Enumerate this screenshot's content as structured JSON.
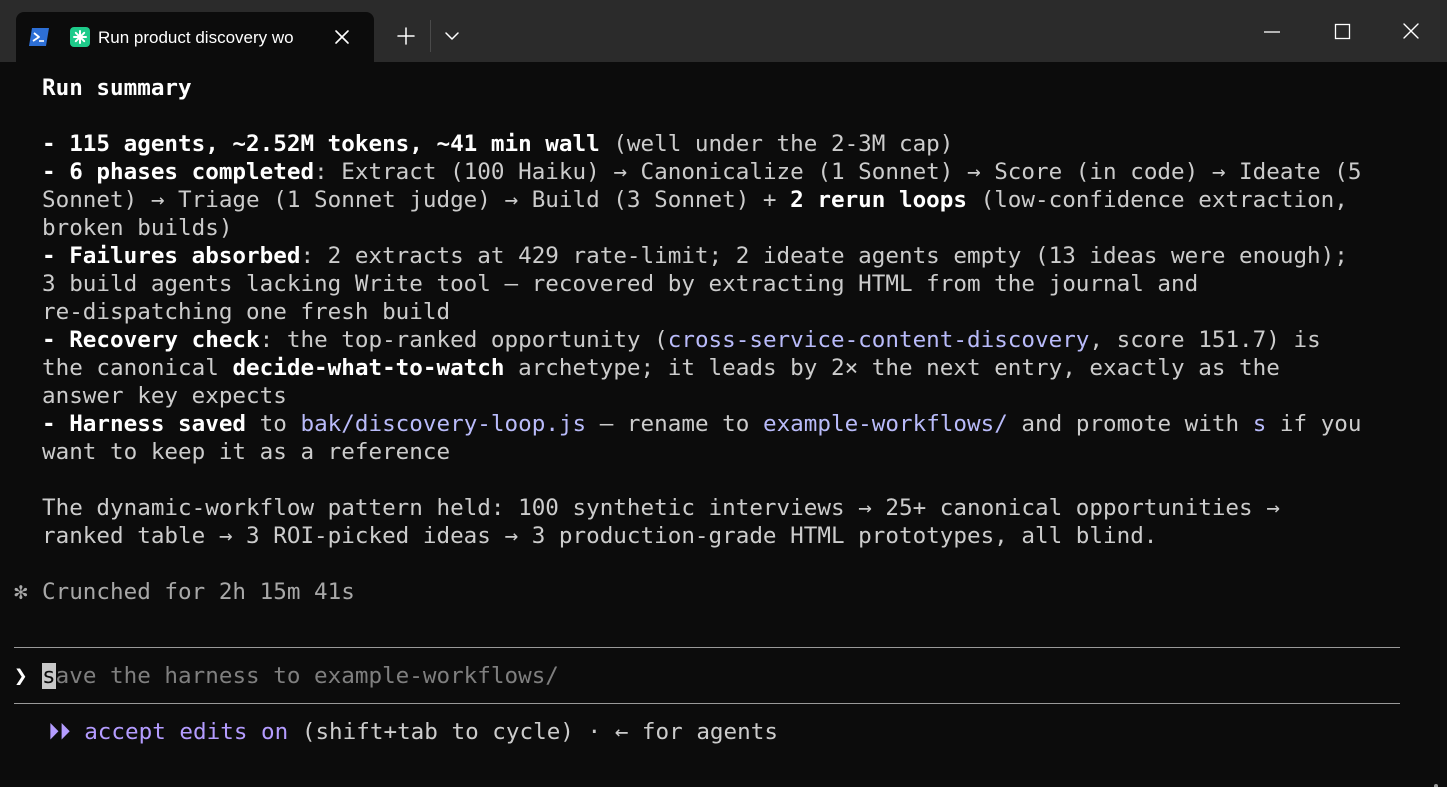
{
  "titlebar": {
    "tab_title": "Run product discovery wo",
    "tab_icon": "powershell-icon",
    "tab_app_icon": "claude-asterisk-icon",
    "accent_color": "#1ecb8a"
  },
  "terminal": {
    "summary_title": "Run summary",
    "l1": {
      "b1": "- 115 agents, ~2.52M tokens, ~41 min wall",
      "t1": " (well under the 2-3M cap)"
    },
    "l2": {
      "b1": "- 6 phases completed",
      "t1": ": Extract (100 Haiku) → Canonicalize (1 Sonnet) → Score (in code) → Ideate (5"
    },
    "l3": {
      "t1": "Sonnet) → Triage (1 Sonnet judge) → Build (3 Sonnet) + ",
      "b1": "2 rerun loops",
      "t2": " (low-confidence extraction,"
    },
    "l4": {
      "t1": "broken builds)"
    },
    "l5": {
      "b1": "- Failures absorbed",
      "t1": ": 2 extracts at 429 rate-limit; 2 ideate agents empty (13 ideas were enough);"
    },
    "l6": {
      "t1": "3 build agents lacking Write tool — recovered by extracting HTML from the journal and"
    },
    "l7": {
      "t1": "re-dispatching one fresh build"
    },
    "l8": {
      "b1": "- Recovery check",
      "t1": ": the top-ranked opportunity (",
      "c1": "cross-service-content-discovery",
      "t2": ", score 151.7) is"
    },
    "l9": {
      "t1": "the canonical ",
      "b1": "decide-what-to-watch",
      "t2": " archetype; it leads by 2× the next entry, exactly as the"
    },
    "l10": {
      "t1": "answer key expects"
    },
    "l11": {
      "b1": "- Harness saved",
      "t1": " to ",
      "c1": "bak/discovery-loop.js",
      "t2": " — rename to ",
      "c2": "example-workflows/",
      "t3": " and promote with ",
      "c3": "s",
      "t4": " if you"
    },
    "l12": {
      "t1": "want to keep it as a reference"
    },
    "l13": {
      "t1": "The dynamic-workflow pattern held: 100 synthetic interviews → 25+ canonical opportunities →"
    },
    "l14": {
      "t1": "ranked table → 3 ROI-picked ideas → 3 production-grade HTML prototypes, all blind."
    },
    "spinner_glyph": "✻",
    "crunched": "Crunched for 2h 15m 41s",
    "prompt_glyph": "❯",
    "input_cursor_char": "s",
    "input_placeholder": "ave the harness to example-workflows/",
    "mode_glyph": "⏵⏵",
    "mode_label": "accept edits on",
    "mode_hint": " (shift+tab to cycle) · ← for agents"
  }
}
